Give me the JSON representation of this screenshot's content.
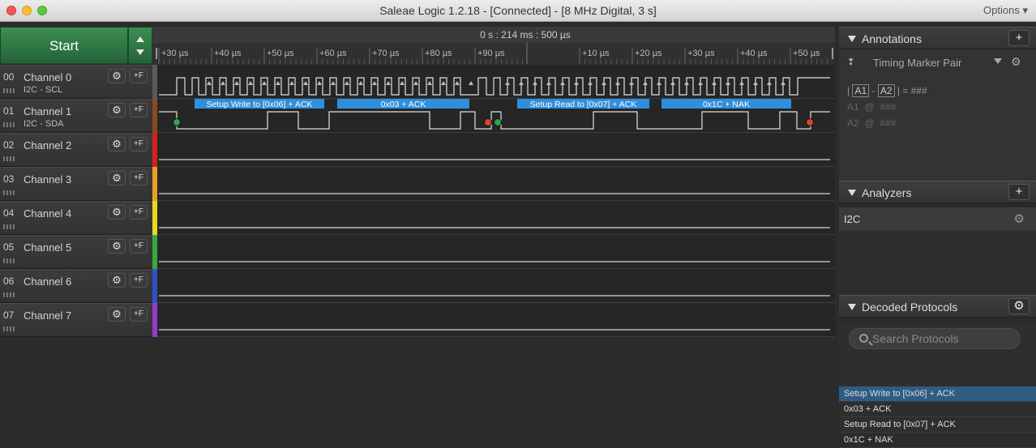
{
  "window": {
    "title": "Saleae Logic 1.2.18 - [Connected] - [8 MHz Digital, 3 s]",
    "options_label": "Options ▾"
  },
  "toolbar": {
    "start_label": "Start"
  },
  "timeline": {
    "center_time": "0 s : 214 ms : 500 µs",
    "ticks": [
      "+30 µs",
      "+40 µs",
      "+50 µs",
      "+60 µs",
      "+70 µs",
      "+80 µs",
      "+90 µs",
      "+10 µs",
      "+20 µs",
      "+30 µs",
      "+40 µs",
      "+50 µs"
    ]
  },
  "channels": [
    {
      "num": "00",
      "name": "Channel 0",
      "sub": "I2C - SCL",
      "color": "#5a5a5a"
    },
    {
      "num": "01",
      "name": "Channel 1",
      "sub": "I2C - SDA",
      "color": "#8a4a1e"
    },
    {
      "num": "02",
      "name": "Channel 2",
      "sub": "",
      "color": "#d42020"
    },
    {
      "num": "03",
      "name": "Channel 3",
      "sub": "",
      "color": "#e8a020"
    },
    {
      "num": "04",
      "name": "Channel 4",
      "sub": "",
      "color": "#e8d820"
    },
    {
      "num": "05",
      "name": "Channel 5",
      "sub": "",
      "color": "#3aa83a"
    },
    {
      "num": "06",
      "name": "Channel 6",
      "sub": "",
      "color": "#3050c8"
    },
    {
      "num": "07",
      "name": "Channel 7",
      "sub": "",
      "color": "#9a3ac8"
    }
  ],
  "decoded_bubbles": [
    "Setup Write to [0x06] + ACK",
    "0x03 + ACK",
    "Setup Read to [0x07] + ACK",
    "0x1C + NAK"
  ],
  "colors": {
    "bubble": "#2f8fdc",
    "start_marker": "#2ea44f",
    "stop_marker": "#d9442e"
  },
  "annotations": {
    "title": "Annotations",
    "add_label": "+",
    "timing_marker": "Timing Marker Pair",
    "line1": {
      "pre": "| ",
      "a1": "A1",
      "mid": " - ",
      "a2": "A2",
      "post": " | = ###"
    },
    "a1_row": "A1  @  ###",
    "a2_row": "A2  @  ###"
  },
  "analyzers": {
    "title": "Analyzers",
    "add_label": "+",
    "items": [
      "I2C"
    ]
  },
  "decoded_protocols": {
    "title": "Decoded Protocols",
    "search_placeholder": "Search Protocols",
    "rows": [
      "Setup Write to [0x06] + ACK",
      "0x03 + ACK",
      "Setup Read to [0x07] + ACK",
      "0x1C + NAK"
    ]
  },
  "icons": {
    "gear": "⚙",
    "edge": "+F"
  }
}
